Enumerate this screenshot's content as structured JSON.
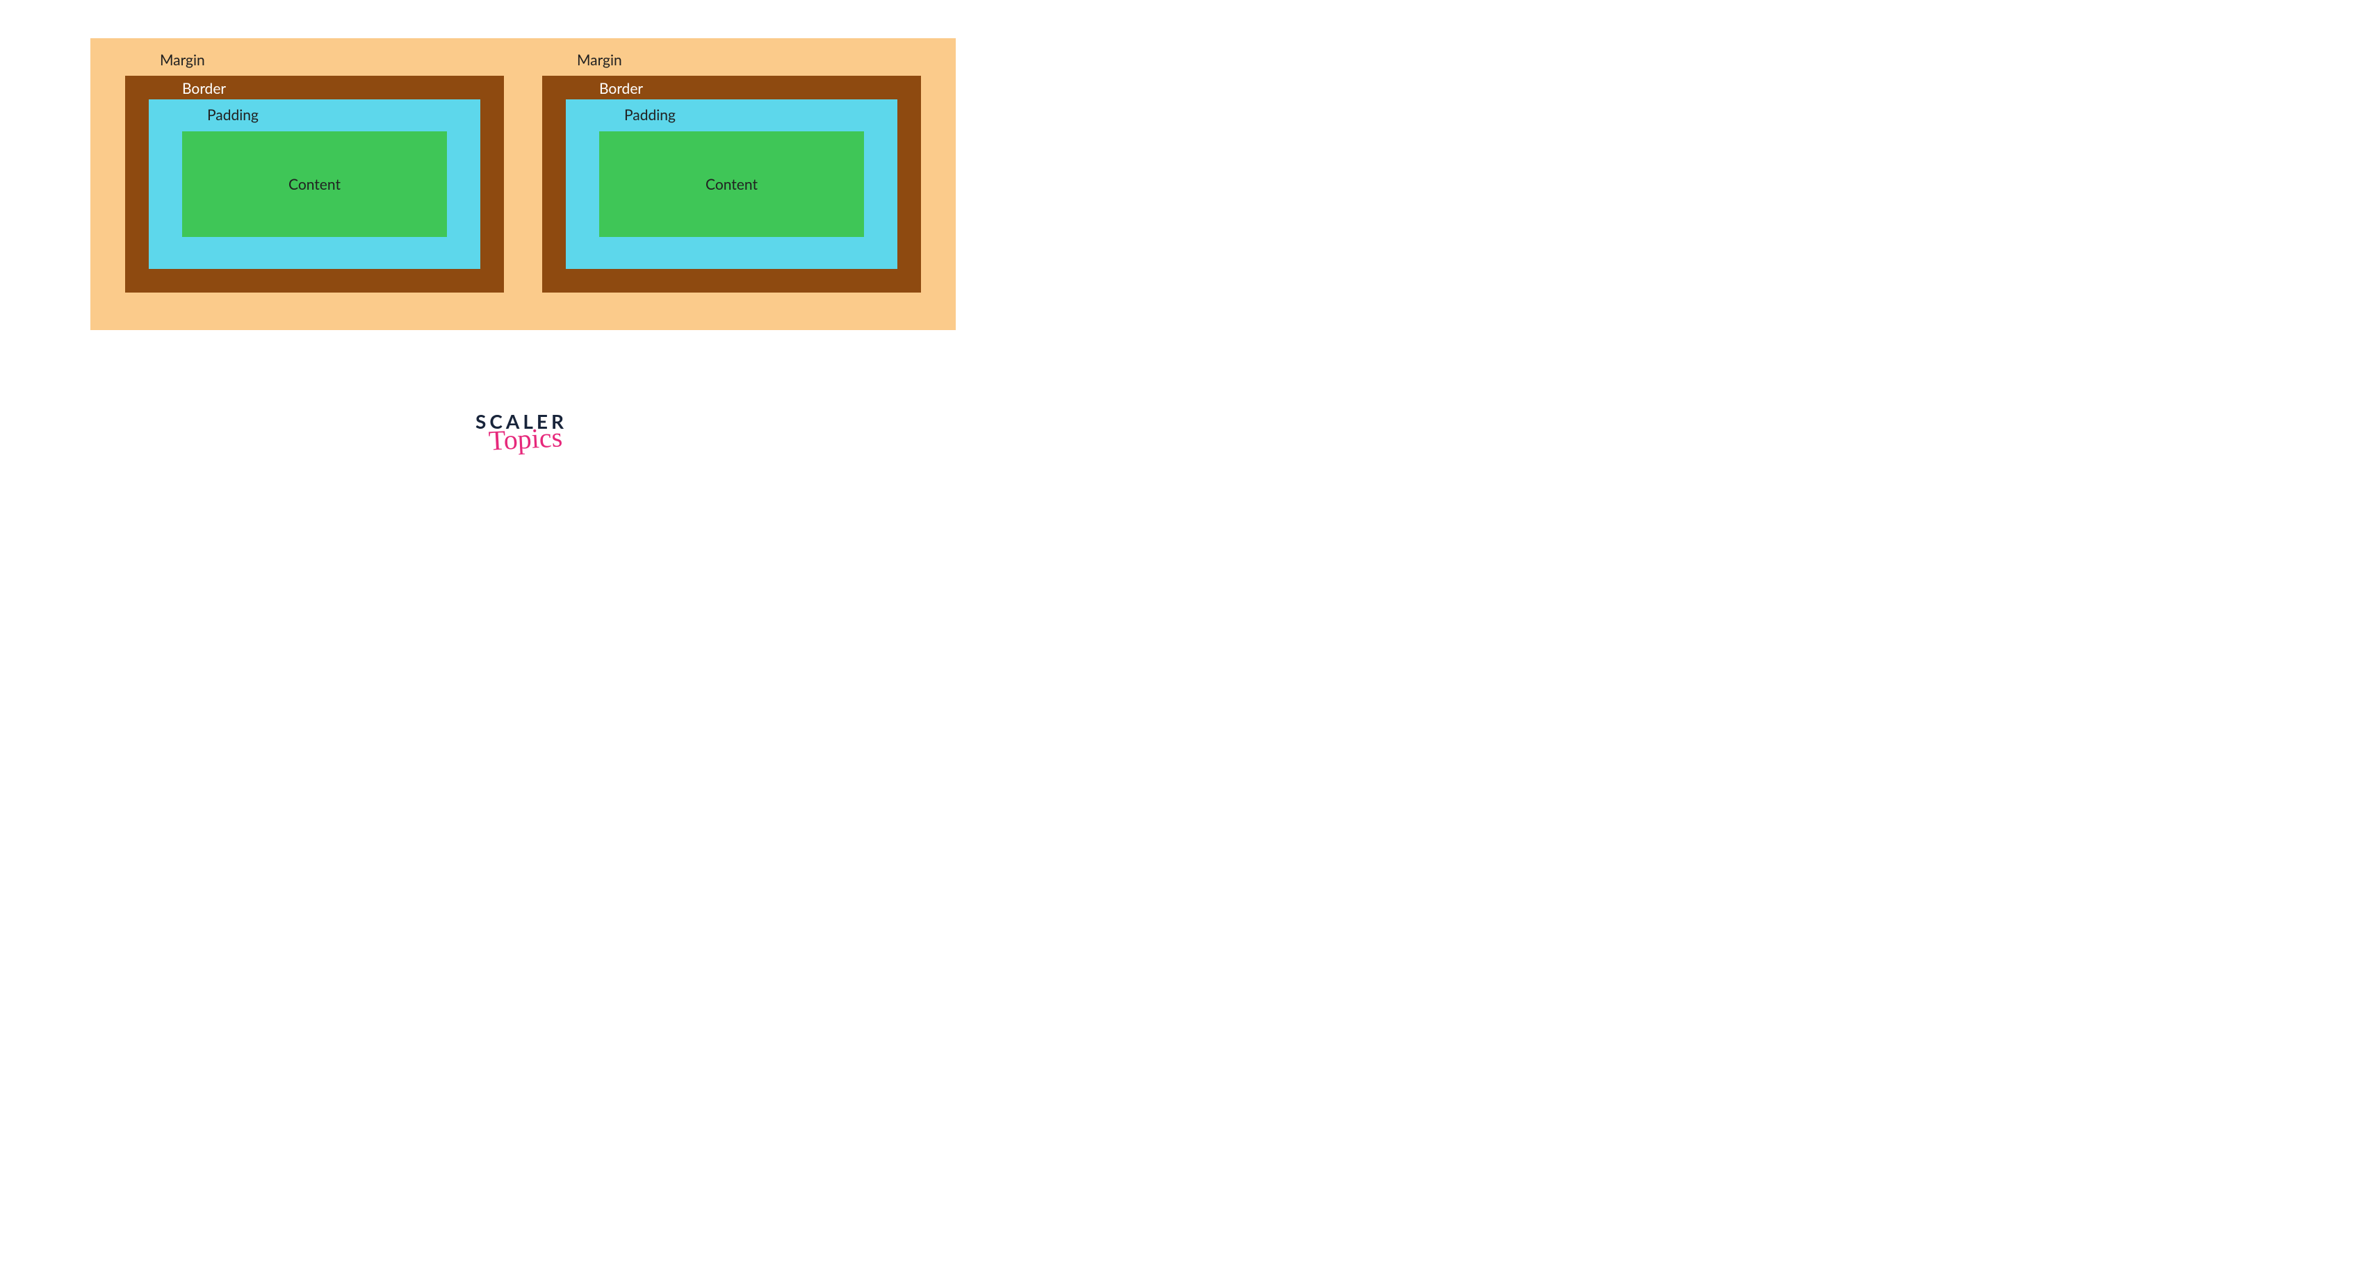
{
  "boxes": [
    {
      "margin_label": "Margin",
      "border_label": "Border",
      "padding_label": "Padding",
      "content_label": "Content"
    },
    {
      "margin_label": "Margin",
      "border_label": "Border",
      "padding_label": "Padding",
      "content_label": "Content"
    }
  ],
  "logo": {
    "line1": "SCALER",
    "line2": "Topics"
  },
  "colors": {
    "margin": "#fbcb8b",
    "border": "#8e4a10",
    "padding": "#5dd7eb",
    "content": "#3fc657",
    "logo_dark": "#18243a",
    "logo_pink": "#e6287b"
  }
}
